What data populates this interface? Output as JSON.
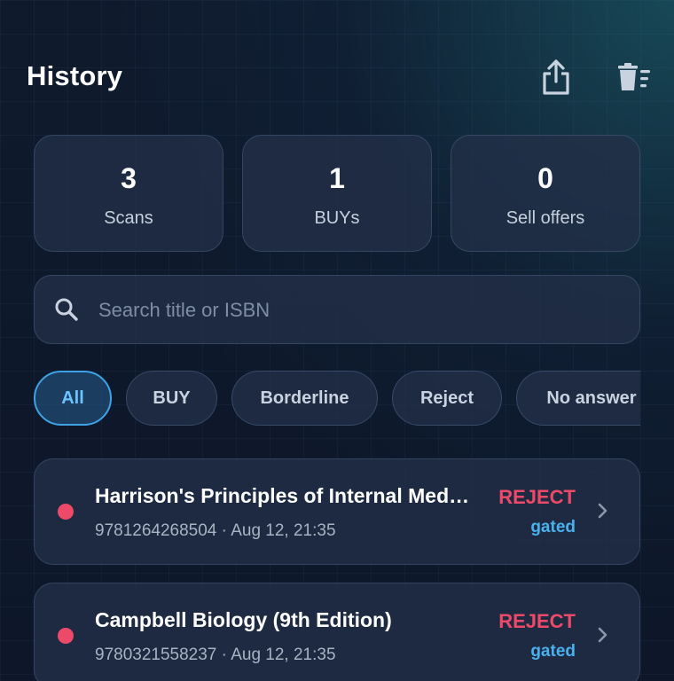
{
  "header": {
    "title": "History",
    "share_icon": "share-icon",
    "clear_icon": "clear-history-icon"
  },
  "stats": [
    {
      "value": "3",
      "label": "Scans"
    },
    {
      "value": "1",
      "label": "BUYs"
    },
    {
      "value": "0",
      "label": "Sell offers"
    }
  ],
  "search": {
    "placeholder": "Search title or ISBN",
    "value": "",
    "icon": "search-icon"
  },
  "filters": [
    {
      "label": "All",
      "active": true
    },
    {
      "label": "BUY",
      "active": false
    },
    {
      "label": "Borderline",
      "active": false
    },
    {
      "label": "Reject",
      "active": false
    },
    {
      "label": "No answer",
      "active": false
    }
  ],
  "scans": [
    {
      "title": "Harrison's Principles of Internal Med…",
      "meta": "9781264268504 · Aug 12, 21:35",
      "verdict": "REJECT",
      "reason": "gated"
    },
    {
      "title": "Campbell Biology (9th Edition)",
      "meta": "9780321558237 · Aug 12, 21:35",
      "verdict": "REJECT",
      "reason": "gated"
    }
  ],
  "colors": {
    "reject": "#ec4a68",
    "accent": "#3ea3e6",
    "reason": "#4ab1ee",
    "background": "#0f1a2d"
  }
}
